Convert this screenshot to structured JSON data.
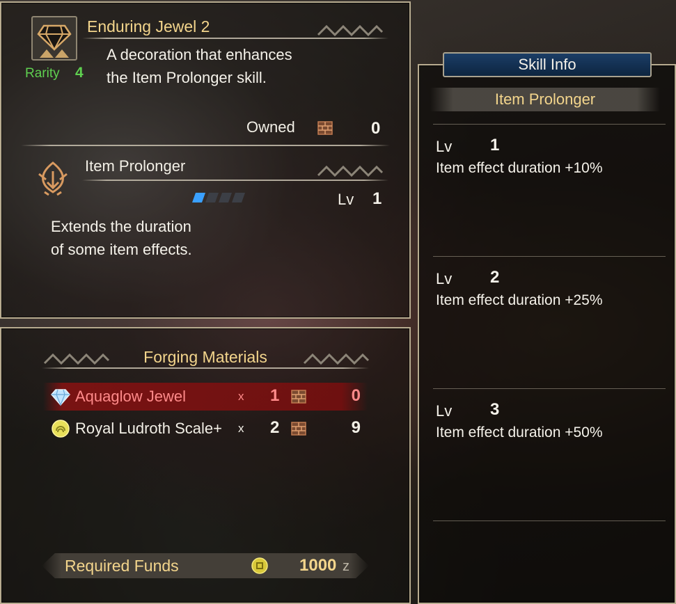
{
  "decoration": {
    "name": "Enduring Jewel 2",
    "description_line1": "A decoration that enhances",
    "description_line2": "the Item Prolonger skill.",
    "rarity_label": "Rarity",
    "rarity_value": "4",
    "owned_label": "Owned",
    "owned_count": "0"
  },
  "skill": {
    "name": "Item Prolonger",
    "level_label": "Lv",
    "level_value": "1",
    "level_fraction": 0.25,
    "description_line1": "Extends the duration",
    "description_line2": "of some item effects."
  },
  "forging": {
    "title": "Forging Materials",
    "materials": [
      {
        "icon": "diamond-jewel-icon",
        "name": "Aquaglow Jewel",
        "x": "x",
        "qty": "1",
        "owned": "0",
        "highlight": true
      },
      {
        "icon": "scale-icon",
        "name": "Royal Ludroth Scale+",
        "x": "x",
        "qty": "2",
        "owned": "9",
        "highlight": false
      }
    ],
    "funds_label": "Required Funds",
    "funds_value": "1000",
    "funds_unit": "z"
  },
  "skill_info": {
    "header": "Skill Info",
    "skill_name": "Item Prolonger",
    "levels": [
      {
        "label": "Lv",
        "value": "1",
        "effect": "Item effect duration +10%"
      },
      {
        "label": "Lv",
        "value": "2",
        "effect": "Item effect duration +25%"
      },
      {
        "label": "Lv",
        "value": "3",
        "effect": "Item effect duration +50%"
      }
    ]
  },
  "colors": {
    "title_gold": "#f3d58c",
    "rarity_green": "#5fd050",
    "highlight_red": "#ff7a7a",
    "skill_header_blue": "#1b3d66",
    "level_bar_blue": "#3aa0ff"
  }
}
